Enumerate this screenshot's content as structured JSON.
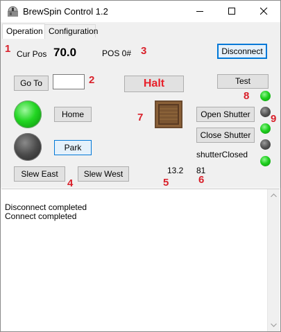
{
  "window": {
    "title": "BrewSpin Control 1.2"
  },
  "tabs": [
    {
      "label": "Operation"
    },
    {
      "label": "Configuration"
    }
  ],
  "markers": [
    "1",
    "2",
    "3",
    "4",
    "5",
    "6",
    "7",
    "8",
    "9"
  ],
  "operation": {
    "cur_pos_label": "Cur Pos",
    "cur_pos_value": "70.0",
    "pos_num_label": "POS 0#",
    "disconnect_label": "Disconnect",
    "goto_label": "Go To",
    "goto_value": "",
    "halt_label": "Halt",
    "test_label": "Test",
    "home_label": "Home",
    "park_label": "Park",
    "open_shutter_label": "Open Shutter",
    "close_shutter_label": "Close Shutter",
    "shutter_status": "shutterClosed",
    "slew_east_label": "Slew East",
    "slew_west_label": "Slew West",
    "value_a": "13.2",
    "value_b": "81"
  },
  "indicators": {
    "home_led": "green",
    "park_led": "gray",
    "leds_right": [
      "green",
      "gray",
      "green",
      "gray",
      "green"
    ]
  },
  "log": {
    "lines": [
      "Disconnect completed",
      "Connect completed"
    ]
  },
  "colors": {
    "marker_red": "#d9202a",
    "halt_red": "#e8202a",
    "accent_blue": "#0078d7",
    "led_green": "#1fd01f"
  }
}
